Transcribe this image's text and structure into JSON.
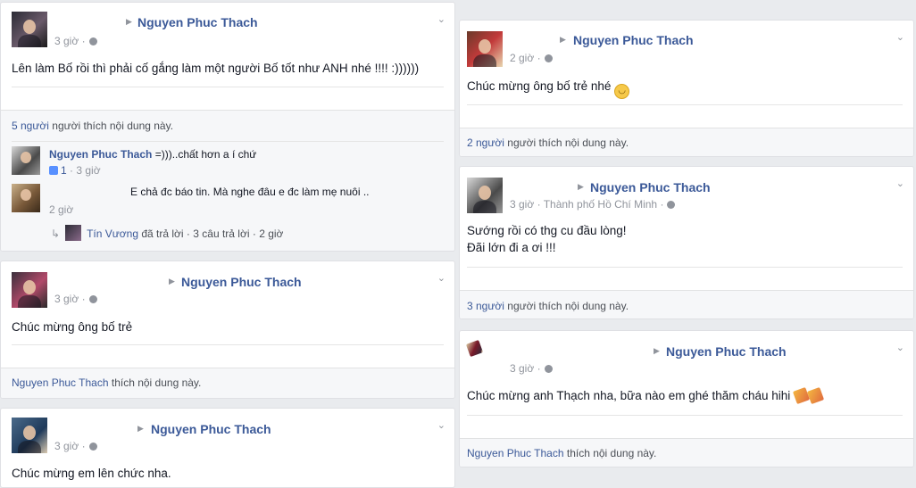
{
  "left": {
    "post1": {
      "author": "Nguyen Phuc Thach",
      "time": "3 giờ",
      "text": "Lên làm Bố rồi thì phải cố gắng làm một người Bố tốt như ANH nhé !!!! :))))))",
      "likes_count": "5 người",
      "likes_suffix": "người thích nội dung này.",
      "comments": [
        {
          "name": "Nguyen Phuc Thach",
          "text": "=)))..chất hơn a í chứ",
          "likes": "1",
          "time": "3 giờ"
        },
        {
          "name": "",
          "text": "E chả đc báo tin. Mà nghe đâu e đc làm mẹ nuôi ..",
          "time": "2 giờ"
        }
      ],
      "reply_summary": {
        "who": "Tín Vương",
        "action": "đã trả lời",
        "count": "3 câu trả lời",
        "time": "2 giờ"
      }
    },
    "post2": {
      "author": "Nguyen Phuc Thach",
      "time": "3 giờ",
      "text": "Chúc mừng ông bố trẻ",
      "liker": "Nguyen Phuc Thach",
      "likes_suffix": "thích nội dung này."
    },
    "post3": {
      "author": "Nguyen Phuc Thach",
      "time": "3 giờ",
      "text": "Chúc mừng em lên chức nha."
    }
  },
  "right": {
    "post1": {
      "author": "Nguyen Phuc Thach",
      "time": "2 giờ",
      "text": "Chúc mừng ông bố trẻ nhé",
      "likes_count": "2 người",
      "likes_suffix": "người thích nội dung này."
    },
    "post2": {
      "author": "Nguyen Phuc Thach",
      "time": "3 giờ",
      "location": "Thành phố Hồ Chí Minh",
      "line1": "Sướng rồi có thg cu đầu lòng!",
      "line2": "Đãi lớn đi a ơi !!!",
      "likes_count": "3 người",
      "likes_suffix": "người thích nội dung này."
    },
    "post3": {
      "author": "Nguyen Phuc Thach",
      "time": "3 giờ",
      "text": "Chúc mừng anh Thạch nha, bữa nào em ghé thăm cháu hihi",
      "liker": "Nguyen Phuc Thach",
      "likes_suffix": "thích nội dung này."
    }
  },
  "icons": {
    "arrow": "▶",
    "chevron": "⌄",
    "separator": "·",
    "reply_arrow": "↳"
  }
}
